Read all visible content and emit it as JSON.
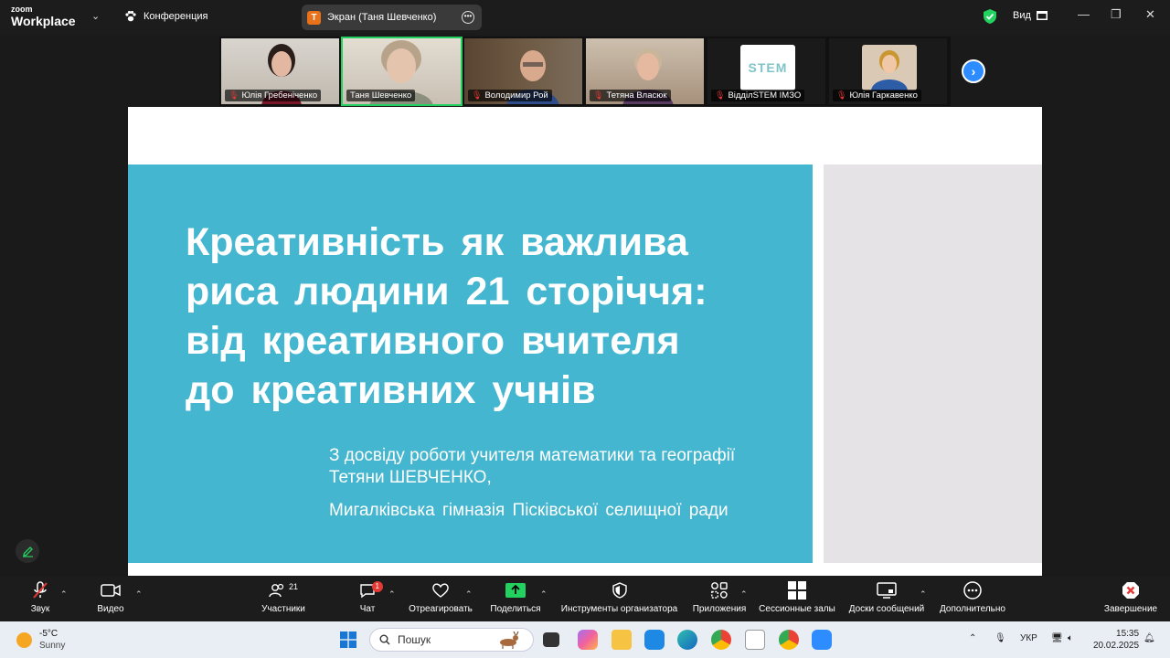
{
  "app": {
    "logo_top": "zoom",
    "logo_bottom": "Workplace",
    "meeting_label": "Конференция"
  },
  "share_pill": {
    "avatar_letter": "T",
    "label": "Экран (Таня Шевченко)"
  },
  "view_label": "Вид",
  "participants": [
    {
      "name": "Юлія Гребеніченко",
      "muted": true,
      "active": false
    },
    {
      "name": "Таня Шевченко",
      "muted": false,
      "active": true
    },
    {
      "name": "Володимир Рой",
      "muted": true,
      "active": false
    },
    {
      "name": "Тетяна Власюк",
      "muted": true,
      "active": false
    },
    {
      "name": "ВідділSTEM IMЗО",
      "muted": true,
      "active": false,
      "logo_text": "STEM"
    },
    {
      "name": "Юлія Гаркавенко",
      "muted": true,
      "active": false
    }
  ],
  "slide": {
    "title": "Креативність як важлива риса людини 21 сторіччя: від креативного вчителя до креативних учнів",
    "subtitle_line1": "З досвіду роботи учителя математики та географії",
    "subtitle_line2": "Тетяни ШЕВЧЕНКО,",
    "school": "Мигалківська гімназія Пісківської селищної ради",
    "main_color": "#45b6cf",
    "side_color": "#e5e3e6"
  },
  "toolbar": {
    "audio": "Звук",
    "video": "Видео",
    "participants": "Участники",
    "participants_count": "21",
    "chat": "Чат",
    "chat_badge": "1",
    "react": "Отреагировать",
    "share": "Поделиться",
    "host_tools": "Инструменты организатора",
    "apps": "Приложения",
    "breakout": "Сессионные залы",
    "whiteboards": "Доски сообщений",
    "more": "Дополнительно",
    "end": "Завершение"
  },
  "taskbar": {
    "temp": "-5°C",
    "weather": "Sunny",
    "search_placeholder": "Пошук",
    "lang": "УКР",
    "time": "15:35",
    "date": "20.02.2025"
  },
  "colors": {
    "accent": "#2d8cff",
    "active_border": "#23d160",
    "share_green": "#23d160",
    "end_red": "#e53935"
  }
}
